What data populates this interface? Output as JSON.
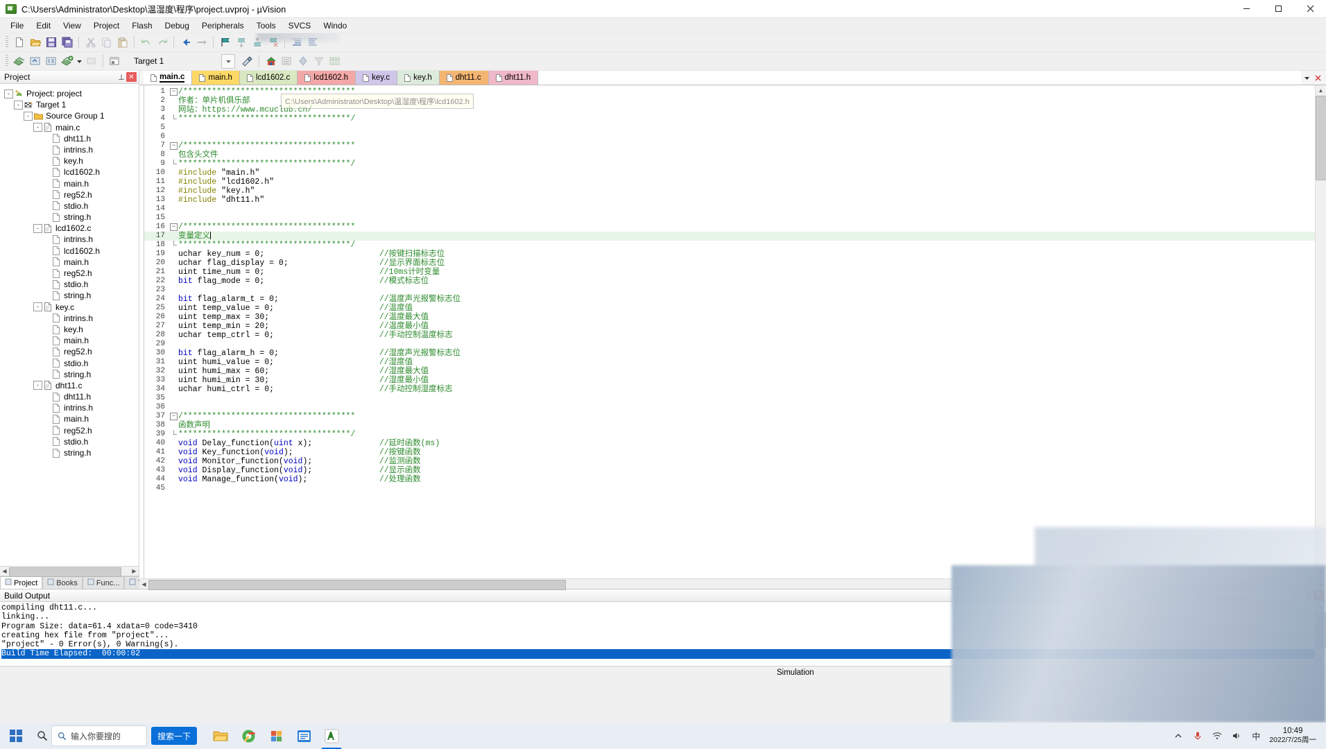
{
  "window": {
    "title": "C:\\Users\\Administrator\\Desktop\\温湿度\\程序\\project.uvproj - µVision",
    "minimize": "—",
    "maximize": "▢",
    "close": "✕"
  },
  "menu": {
    "items": [
      "File",
      "Edit",
      "View",
      "Project",
      "Flash",
      "Debug",
      "Peripherals",
      "Tools",
      "SVCS",
      "Windo"
    ]
  },
  "toolbar2": {
    "target_label": "Target 1"
  },
  "project_pane": {
    "title": "Project",
    "pin": "⊥",
    "close": "✕",
    "tabs": [
      {
        "label": "Project",
        "icon": "project-icon",
        "active": true
      },
      {
        "label": "Books",
        "icon": "books-icon",
        "active": false
      },
      {
        "label": "Func...",
        "icon": "functions-icon",
        "active": false
      },
      {
        "label": "Temp...",
        "icon": "templates-icon",
        "active": false
      }
    ],
    "tree": [
      {
        "label": "Project: project",
        "depth": 0,
        "icon": "project-icon",
        "expander": "-"
      },
      {
        "label": "Target 1",
        "depth": 1,
        "icon": "target-icon",
        "expander": "-"
      },
      {
        "label": "Source Group 1",
        "depth": 2,
        "icon": "folder-icon",
        "expander": "-"
      },
      {
        "label": "main.c",
        "depth": 3,
        "icon": "cfile-icon",
        "expander": "-"
      },
      {
        "label": "dht11.h",
        "depth": 4,
        "icon": "hfile-icon",
        "expander": ""
      },
      {
        "label": "intrins.h",
        "depth": 4,
        "icon": "hfile-icon",
        "expander": ""
      },
      {
        "label": "key.h",
        "depth": 4,
        "icon": "hfile-icon",
        "expander": ""
      },
      {
        "label": "lcd1602.h",
        "depth": 4,
        "icon": "hfile-icon",
        "expander": ""
      },
      {
        "label": "main.h",
        "depth": 4,
        "icon": "hfile-icon",
        "expander": ""
      },
      {
        "label": "reg52.h",
        "depth": 4,
        "icon": "hfile-icon",
        "expander": ""
      },
      {
        "label": "stdio.h",
        "depth": 4,
        "icon": "hfile-icon",
        "expander": ""
      },
      {
        "label": "string.h",
        "depth": 4,
        "icon": "hfile-icon",
        "expander": ""
      },
      {
        "label": "lcd1602.c",
        "depth": 3,
        "icon": "cfile-icon",
        "expander": "-"
      },
      {
        "label": "intrins.h",
        "depth": 4,
        "icon": "hfile-icon",
        "expander": ""
      },
      {
        "label": "lcd1602.h",
        "depth": 4,
        "icon": "hfile-icon",
        "expander": ""
      },
      {
        "label": "main.h",
        "depth": 4,
        "icon": "hfile-icon",
        "expander": ""
      },
      {
        "label": "reg52.h",
        "depth": 4,
        "icon": "hfile-icon",
        "expander": ""
      },
      {
        "label": "stdio.h",
        "depth": 4,
        "icon": "hfile-icon",
        "expander": ""
      },
      {
        "label": "string.h",
        "depth": 4,
        "icon": "hfile-icon",
        "expander": ""
      },
      {
        "label": "key.c",
        "depth": 3,
        "icon": "cfile-icon",
        "expander": "-"
      },
      {
        "label": "intrins.h",
        "depth": 4,
        "icon": "hfile-icon",
        "expander": ""
      },
      {
        "label": "key.h",
        "depth": 4,
        "icon": "hfile-icon",
        "expander": ""
      },
      {
        "label": "main.h",
        "depth": 4,
        "icon": "hfile-icon",
        "expander": ""
      },
      {
        "label": "reg52.h",
        "depth": 4,
        "icon": "hfile-icon",
        "expander": ""
      },
      {
        "label": "stdio.h",
        "depth": 4,
        "icon": "hfile-icon",
        "expander": ""
      },
      {
        "label": "string.h",
        "depth": 4,
        "icon": "hfile-icon",
        "expander": ""
      },
      {
        "label": "dht11.c",
        "depth": 3,
        "icon": "cfile-icon",
        "expander": "-"
      },
      {
        "label": "dht11.h",
        "depth": 4,
        "icon": "hfile-icon",
        "expander": ""
      },
      {
        "label": "intrins.h",
        "depth": 4,
        "icon": "hfile-icon",
        "expander": ""
      },
      {
        "label": "main.h",
        "depth": 4,
        "icon": "hfile-icon",
        "expander": ""
      },
      {
        "label": "reg52.h",
        "depth": 4,
        "icon": "hfile-icon",
        "expander": ""
      },
      {
        "label": "stdio.h",
        "depth": 4,
        "icon": "hfile-icon",
        "expander": ""
      },
      {
        "label": "string.h",
        "depth": 4,
        "icon": "hfile-icon",
        "expander": ""
      }
    ]
  },
  "editor": {
    "tabs": [
      {
        "label": "main.c",
        "color": "#ffffff",
        "active": true
      },
      {
        "label": "main.h",
        "color": "#ffd966",
        "active": false
      },
      {
        "label": "lcd1602.c",
        "color": "#d9e8c0",
        "active": false
      },
      {
        "label": "lcd1602.h",
        "color": "#f4a7a7",
        "active": false
      },
      {
        "label": "key.c",
        "color": "#cfc6ea",
        "active": false
      },
      {
        "label": "key.h",
        "color": "#ddebdd",
        "active": false
      },
      {
        "label": "dht11.c",
        "color": "#f5b572",
        "active": false
      },
      {
        "label": "dht11.h",
        "color": "#f0b8c8",
        "active": false
      }
    ],
    "tooltip": "C:\\Users\\Administrator\\Desktop\\温湿度\\程序\\lcd1602.h",
    "lines": [
      {
        "n": 1,
        "fold": "box-open",
        "code": "/************************************",
        "cls": "cm",
        "cmt": ""
      },
      {
        "n": 2,
        "fold": "bar",
        "code": "作者：单片机俱乐部",
        "cls": "cm",
        "cmt": ""
      },
      {
        "n": 3,
        "fold": "bar",
        "code": "网站：https://www.mcuclub.cn/",
        "cls": "cm",
        "cmt": ""
      },
      {
        "n": 4,
        "fold": "end",
        "code": "************************************/",
        "cls": "cm",
        "cmt": ""
      },
      {
        "n": 5,
        "fold": "",
        "code": "",
        "cls": "cm",
        "cmt": ""
      },
      {
        "n": 6,
        "fold": "",
        "code": "",
        "cls": "cm",
        "cmt": ""
      },
      {
        "n": 7,
        "fold": "box-open",
        "code": "/************************************",
        "cls": "cm",
        "cmt": ""
      },
      {
        "n": 8,
        "fold": "bar",
        "code": "包含头文件",
        "cls": "cm",
        "cmt": ""
      },
      {
        "n": 9,
        "fold": "end",
        "code": "************************************/",
        "cls": "cm",
        "cmt": ""
      },
      {
        "n": 10,
        "fold": "",
        "code": "#include \"main.h\"",
        "cls": "inc",
        "cmt": ""
      },
      {
        "n": 11,
        "fold": "",
        "code": "#include \"lcd1602.h\"",
        "cls": "inc",
        "cmt": ""
      },
      {
        "n": 12,
        "fold": "",
        "code": "#include \"key.h\"",
        "cls": "inc",
        "cmt": ""
      },
      {
        "n": 13,
        "fold": "",
        "code": "#include \"dht11.h\"",
        "cls": "inc",
        "cmt": ""
      },
      {
        "n": 14,
        "fold": "",
        "code": "",
        "cls": "",
        "cmt": ""
      },
      {
        "n": 15,
        "fold": "",
        "code": "",
        "cls": "",
        "cmt": ""
      },
      {
        "n": 16,
        "fold": "box-open",
        "code": "/************************************",
        "cls": "cm",
        "cmt": ""
      },
      {
        "n": 17,
        "fold": "bar",
        "code": "变量定义",
        "cls": "cm",
        "cmt": "",
        "highlight": true,
        "caret": true
      },
      {
        "n": 18,
        "fold": "end",
        "code": "************************************/",
        "cls": "cm",
        "cmt": ""
      },
      {
        "n": 19,
        "fold": "",
        "code": "uchar key_num = 0;",
        "cls": "code",
        "cmt": "//按键扫描标志位"
      },
      {
        "n": 20,
        "fold": "",
        "code": "uchar flag_display = 0;",
        "cls": "code",
        "cmt": "//显示界面标志位"
      },
      {
        "n": 21,
        "fold": "",
        "code": "uint time_num = 0;",
        "cls": "code",
        "cmt": "//10ms计时变量"
      },
      {
        "n": 22,
        "fold": "",
        "code": "bit flag_mode = 0;",
        "cls": "code-kw",
        "cmt": "//模式标志位"
      },
      {
        "n": 23,
        "fold": "",
        "code": "",
        "cls": "",
        "cmt": ""
      },
      {
        "n": 24,
        "fold": "",
        "code": "bit flag_alarm_t = 0;",
        "cls": "code-kw",
        "cmt": "//温度声光报警标志位"
      },
      {
        "n": 25,
        "fold": "",
        "code": "uint temp_value = 0;",
        "cls": "code",
        "cmt": "//温度值"
      },
      {
        "n": 26,
        "fold": "",
        "code": "uint temp_max = 30;",
        "cls": "code",
        "cmt": "//温度最大值"
      },
      {
        "n": 27,
        "fold": "",
        "code": "uint temp_min = 20;",
        "cls": "code",
        "cmt": "//温度最小值"
      },
      {
        "n": 28,
        "fold": "",
        "code": "uchar temp_ctrl = 0;",
        "cls": "code",
        "cmt": "//手动控制温度标志"
      },
      {
        "n": 29,
        "fold": "",
        "code": "",
        "cls": "",
        "cmt": ""
      },
      {
        "n": 30,
        "fold": "",
        "code": "bit flag_alarm_h = 0;",
        "cls": "code-kw",
        "cmt": "//湿度声光报警标志位"
      },
      {
        "n": 31,
        "fold": "",
        "code": "uint humi_value = 0;",
        "cls": "code",
        "cmt": "//湿度值"
      },
      {
        "n": 32,
        "fold": "",
        "code": "uint humi_max = 60;",
        "cls": "code",
        "cmt": "//湿度最大值"
      },
      {
        "n": 33,
        "fold": "",
        "code": "uint humi_min = 30;",
        "cls": "code",
        "cmt": "//湿度最小值"
      },
      {
        "n": 34,
        "fold": "",
        "code": "uchar humi_ctrl = 0;",
        "cls": "code",
        "cmt": "//手动控制湿度标志"
      },
      {
        "n": 35,
        "fold": "",
        "code": "",
        "cls": "",
        "cmt": ""
      },
      {
        "n": 36,
        "fold": "",
        "code": "",
        "cls": "",
        "cmt": ""
      },
      {
        "n": 37,
        "fold": "box-open",
        "code": "/************************************",
        "cls": "cm",
        "cmt": ""
      },
      {
        "n": 38,
        "fold": "bar",
        "code": "函数声明",
        "cls": "cm",
        "cmt": ""
      },
      {
        "n": 39,
        "fold": "end",
        "code": "************************************/",
        "cls": "cm",
        "cmt": ""
      },
      {
        "n": 40,
        "fold": "",
        "code": "void Delay_function(uint x);",
        "cls": "proto",
        "cmt": "//延时函数(ms)"
      },
      {
        "n": 41,
        "fold": "",
        "code": "void Key_function(void);",
        "cls": "proto",
        "cmt": "//按键函数"
      },
      {
        "n": 42,
        "fold": "",
        "code": "void Monitor_function(void);",
        "cls": "proto",
        "cmt": "//监测函数"
      },
      {
        "n": 43,
        "fold": "",
        "code": "void Display_function(void);",
        "cls": "proto",
        "cmt": "//显示函数"
      },
      {
        "n": 44,
        "fold": "",
        "code": "void Manage_function(void);",
        "cls": "proto",
        "cmt": "//处理函数"
      },
      {
        "n": 45,
        "fold": "",
        "code": "",
        "cls": "",
        "cmt": ""
      }
    ]
  },
  "build_output": {
    "title": "Build Output",
    "lines": [
      {
        "text": "compiling dht11.c...",
        "selected": false
      },
      {
        "text": "linking...",
        "selected": false
      },
      {
        "text": "Program Size: data=61.4 xdata=0 code=3410",
        "selected": false
      },
      {
        "text": "creating hex file from \"project\"...",
        "selected": false
      },
      {
        "text": "\"project\" - 0 Error(s), 0 Warning(s).",
        "selected": false
      },
      {
        "text": "Build Time Elapsed:  00:00:02",
        "selected": true
      }
    ]
  },
  "statusbar": {
    "simulation": "Simulation"
  },
  "taskbar": {
    "search_placeholder": "输入你要搜的",
    "search_button": "搜索一下",
    "clock_time": "10:49",
    "clock_date": "2022/7/25周一",
    "ime": "中"
  },
  "colors": {
    "accent": "#0a6fd8",
    "selection": "#0a64c8",
    "comment": "#2e8b2e",
    "keyword": "#0000c0",
    "preprocessor": "#808000",
    "highlight_line": "#e7f5e7"
  }
}
